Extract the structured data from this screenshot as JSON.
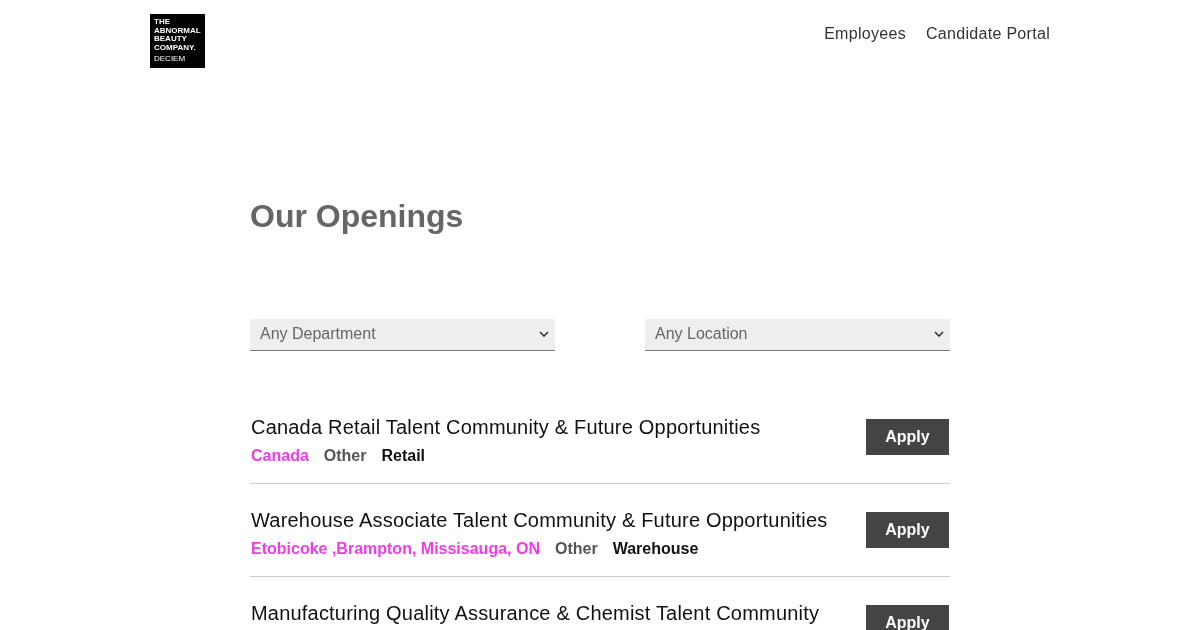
{
  "logo": {
    "lines": [
      "THE",
      "ABNORMAL",
      "BEAUTY",
      "COMPANY."
    ],
    "sub": "DECIEM"
  },
  "nav": [
    "Employees",
    "Candidate Portal"
  ],
  "heading": "Our Openings",
  "filters": [
    {
      "value": "Any Department"
    },
    {
      "value": "Any Location"
    }
  ],
  "openings": [
    {
      "title": "Canada Retail Talent Community & Future Opportunities",
      "location": "Canada",
      "type": "Other",
      "department": "Retail",
      "button": "Apply"
    },
    {
      "title": "Warehouse Associate Talent Community & Future Opportunities",
      "location": "Etobicoke ,Brampton, Missisauga, ON",
      "type": "Other",
      "department": "Warehouse",
      "button": "Apply"
    },
    {
      "title": "Manufacturing Quality Assurance & Chemist Talent Community",
      "button": "Apply"
    }
  ]
}
